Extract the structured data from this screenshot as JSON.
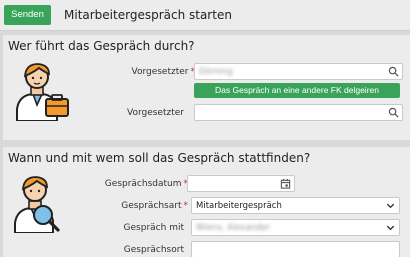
{
  "header": {
    "send_label": "Senden",
    "title": "Mitarbeitergespräch starten"
  },
  "section1": {
    "title": "Wer führt das Gespräch durch?",
    "supervisor_label": "Vorgesetzter",
    "supervisor_value": "Dörning",
    "delegate_button": "Das Gespräch an eine andere FK delgeiren",
    "supervisor2_label": "Vorgesetzter",
    "supervisor2_value": ""
  },
  "section2": {
    "title": "Wann und mit wem soll das Gespräch stattfinden?",
    "date_label": "Gesprächsdatum",
    "date_value": "",
    "type_label": "Gesprächsart",
    "type_value": "Mitarbeitergespräch",
    "with_label": "Gespräch mit",
    "with_value": "Wiens, Alexander",
    "place_label": "Gesprächsort",
    "place_value": ""
  },
  "icons": {
    "field_search": "search-icon",
    "date_picker": "calendar-icon",
    "select_caret": "chevron-down-icon",
    "illustration_1": "person-with-briefcase-icon",
    "illustration_2": "person-with-magnifier-icon"
  },
  "colors": {
    "primary_green": "#3aa35a",
    "required_asterisk": "#d9263b",
    "card_bg": "#ececec",
    "page_bg": "#d9d9d9"
  }
}
